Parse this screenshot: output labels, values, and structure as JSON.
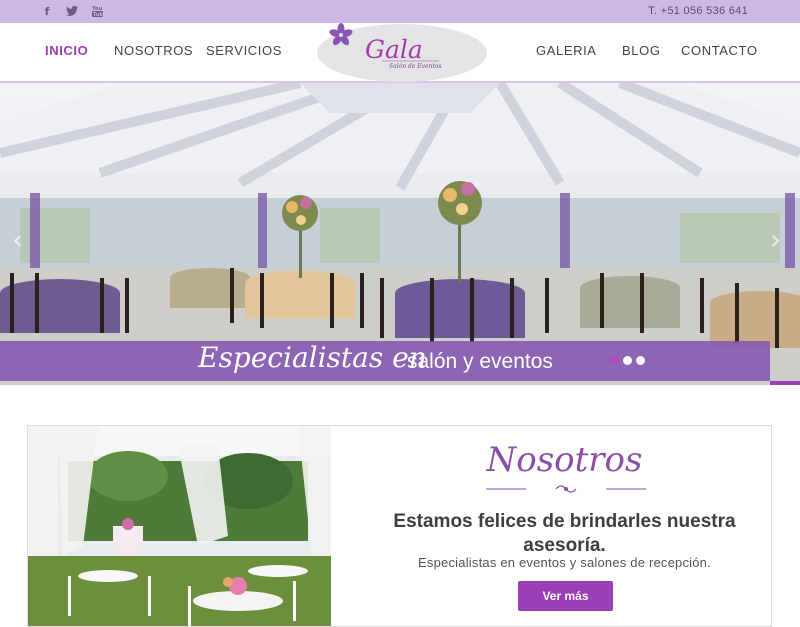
{
  "topbar": {
    "social_icons": [
      "facebook-icon",
      "twitter-icon",
      "youtube-icon"
    ],
    "phone": "T. +51 056 536 641"
  },
  "nav": {
    "left": [
      "INICIO",
      "NOSOTROS",
      "SERVICIOS"
    ],
    "right": [
      "GALERIA",
      "BLOG",
      "CONTACTO"
    ],
    "active": "INICIO"
  },
  "logo": {
    "name": "Gala",
    "tagline": "Salón de Eventos"
  },
  "hero": {
    "caption_script": "Especialistas en",
    "caption_plain": "salón y eventos",
    "slides_total": 3,
    "active_slide": 1
  },
  "nosotros": {
    "title": "Nosotros",
    "heading": "Estamos felices de brindarles nuestra asesoría.",
    "subheading": "Especialistas en eventos y salones de recepción.",
    "button": "Ver más"
  },
  "colors": {
    "accent": "#9a3fb5",
    "topbar": "#cdb8e5",
    "caption_bg": "#8557b2"
  }
}
